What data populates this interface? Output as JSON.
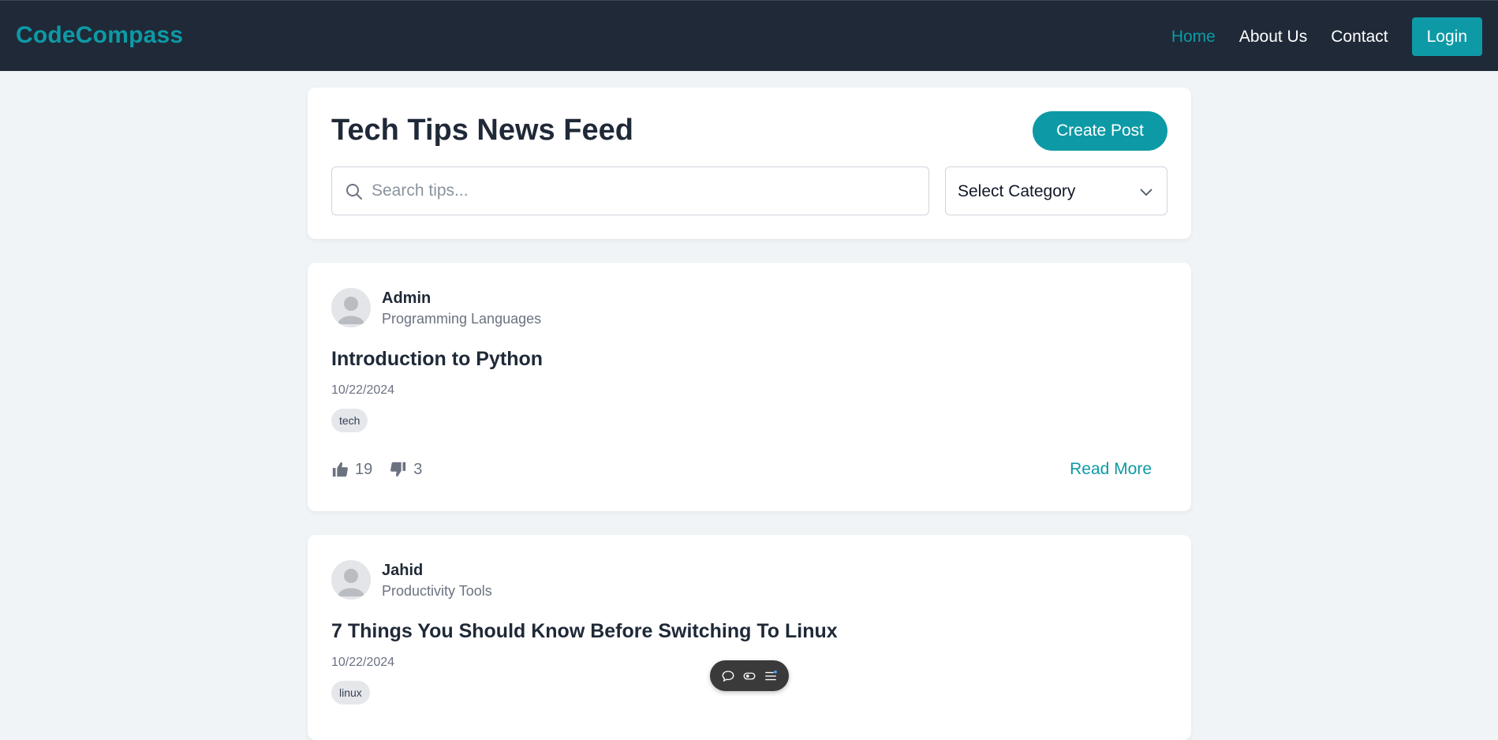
{
  "nav": {
    "brand": "CodeCompass",
    "links": [
      {
        "label": "Home",
        "active": true
      },
      {
        "label": "About Us",
        "active": false
      },
      {
        "label": "Contact",
        "active": false
      }
    ],
    "login_label": "Login"
  },
  "header": {
    "title": "Tech Tips News Feed",
    "create_label": "Create Post",
    "search_placeholder": "Search tips...",
    "category_selected": "Select Category"
  },
  "posts": [
    {
      "author": "Admin",
      "category": "Programming Languages",
      "title": "Introduction to Python",
      "date": "10/22/2024",
      "tag": "tech",
      "likes": "19",
      "dislikes": "3",
      "read_more": "Read More"
    },
    {
      "author": "Jahid",
      "category": "Productivity Tools",
      "title": "7 Things You Should Know Before Switching To Linux",
      "date": "10/22/2024",
      "tag": "linux"
    }
  ],
  "colors": {
    "accent": "#0d9aa6",
    "nav_bg": "#1f2937",
    "page_bg": "#f1f4f6"
  },
  "icons": [
    "search-icon",
    "chevron-down-icon",
    "thumbs-up-icon",
    "thumbs-down-icon",
    "comment-icon",
    "toggle-icon",
    "list-settings-icon"
  ]
}
